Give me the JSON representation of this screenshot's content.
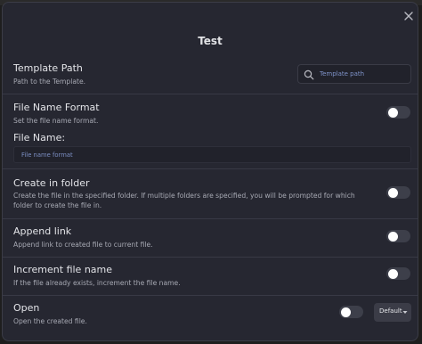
{
  "modal": {
    "title": "Test",
    "close_icon": "close-icon"
  },
  "settings": {
    "template_path": {
      "name": "Template Path",
      "desc": "Path to the Template.",
      "input_placeholder": "Template path",
      "icon": "search-icon"
    },
    "file_name_format": {
      "name": "File Name Format",
      "desc": "Set the file name format.",
      "toggle_on": false
    },
    "file_name": {
      "label": "File Name:",
      "input_placeholder": "File name format"
    },
    "create_in_folder": {
      "name": "Create in folder",
      "desc": "Create the file in the specified folder. If multiple folders are specified, you will be prompted for which folder to create the file in.",
      "toggle_on": false
    },
    "append_link": {
      "name": "Append link",
      "desc": "Append link to created file to current file.",
      "toggle_on": false
    },
    "increment_file_name": {
      "name": "Increment file name",
      "desc": "If the file already exists, increment the file name.",
      "toggle_on": false
    },
    "open": {
      "name": "Open",
      "desc": "Open the created file.",
      "toggle_on": false,
      "dropdown_value": "Default",
      "dropdown_icon": "chevron-down-icon"
    }
  },
  "colors": {
    "background": "#262731",
    "accent_placeholder": "#7f93c9",
    "toggle_off": "#3d3f4a"
  }
}
